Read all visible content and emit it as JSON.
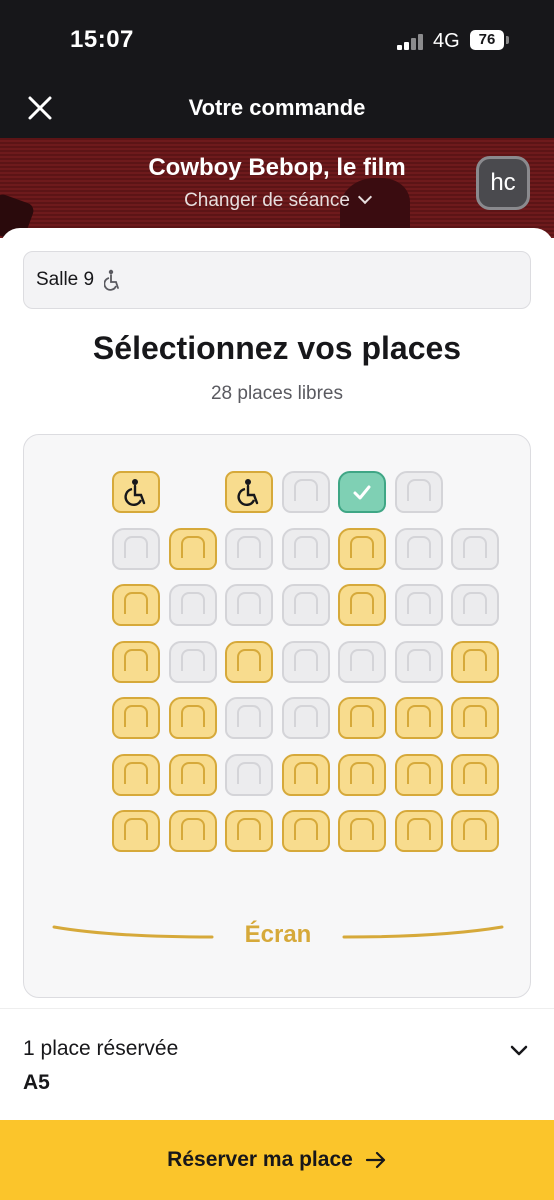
{
  "status_bar": {
    "time": "15:07",
    "network": "4G",
    "battery": "76"
  },
  "nav": {
    "title": "Votre commande"
  },
  "film": {
    "title": "Cowboy Bebop, le film",
    "change_session": "Changer de séance",
    "avatar_initials": "hc"
  },
  "room": {
    "label": "Salle 9"
  },
  "selection": {
    "title": "Sélectionnez vos places",
    "free_seats": "28 places libres"
  },
  "seat_map": {
    "rows": [
      [
        "wheelchair",
        "empty",
        "wheelchair",
        "taken",
        "selected",
        "taken",
        "empty"
      ],
      [
        "taken",
        "available",
        "taken",
        "taken",
        "available",
        "taken",
        "taken"
      ],
      [
        "available",
        "taken",
        "taken",
        "taken",
        "available",
        "taken",
        "taken"
      ],
      [
        "available",
        "taken",
        "available",
        "taken",
        "taken",
        "taken",
        "available"
      ],
      [
        "available",
        "available",
        "taken",
        "taken",
        "available",
        "available",
        "available"
      ],
      [
        "available",
        "available",
        "taken",
        "available",
        "available",
        "available",
        "available"
      ],
      [
        "available",
        "available",
        "available",
        "available",
        "available",
        "available",
        "available"
      ]
    ],
    "screen_label": "Écran"
  },
  "footer": {
    "reserved_count": "1 place réservée",
    "reserved_seats": "A5"
  },
  "cta": {
    "label": "Réserver ma place"
  },
  "colors": {
    "accent": "#fbc52b",
    "seat_available": "#f8dc8e",
    "seat_border": "#d6a93a",
    "seat_selected": "#7fd0b4",
    "seat_taken": "#ececee",
    "dark": "#17171a"
  }
}
